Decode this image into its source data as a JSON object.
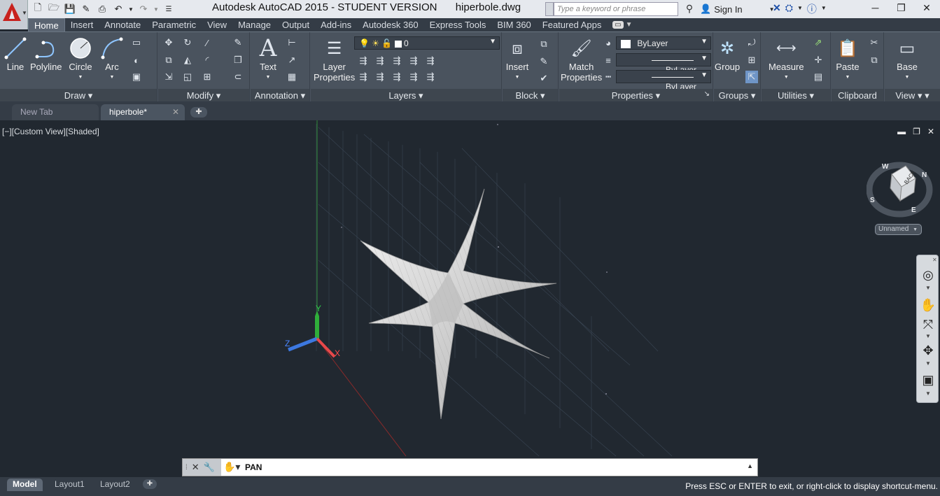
{
  "titlebar": {
    "app_title": "Autodesk AutoCAD 2015 - STUDENT VERSION",
    "file_name": "hiperbole.dwg",
    "search_placeholder": "Type a keyword or phrase",
    "sign_in": "Sign In"
  },
  "ribbon_tabs": [
    "Home",
    "Insert",
    "Annotate",
    "Parametric",
    "View",
    "Manage",
    "Output",
    "Add-ins",
    "Autodesk 360",
    "Express Tools",
    "BIM 360",
    "Featured Apps"
  ],
  "ribbon": {
    "draw": {
      "title": "Draw",
      "line": "Line",
      "polyline": "Polyline",
      "circle": "Circle",
      "arc": "Arc"
    },
    "modify": {
      "title": "Modify"
    },
    "annotation": {
      "title": "Annotation",
      "text": "Text"
    },
    "layers": {
      "title": "Layers",
      "layer_properties_1": "Layer",
      "layer_properties_2": "Properties",
      "current_layer": "0"
    },
    "block": {
      "title": "Block",
      "insert": "Insert"
    },
    "properties": {
      "title": "Properties",
      "match_1": "Match",
      "match_2": "Properties",
      "color": "ByLayer",
      "linetype": "ByLayer",
      "lineweight": "ByLayer"
    },
    "groups": {
      "title": "Groups",
      "group": "Group"
    },
    "utilities": {
      "title": "Utilities",
      "measure": "Measure"
    },
    "clipboard": {
      "title": "Clipboard",
      "paste": "Paste"
    },
    "view": {
      "title": "View",
      "base": "Base"
    }
  },
  "doc_tabs": {
    "new_tab": "New Tab",
    "active": "hiperbole*"
  },
  "viewport": {
    "label": "[−][Custom View][Shaded]",
    "viewcube_face": "BACK",
    "compass": [
      "N",
      "E",
      "S",
      "W"
    ],
    "named_view": "Unnamed",
    "ucs_x": "X",
    "ucs_y": "Y",
    "ucs_z": "Z"
  },
  "command_line": {
    "text": "PAN"
  },
  "layout_tabs": [
    "Model",
    "Layout1",
    "Layout2"
  ],
  "status_text": "Press ESC or ENTER to exit, or right-click to display shortcut-menu."
}
